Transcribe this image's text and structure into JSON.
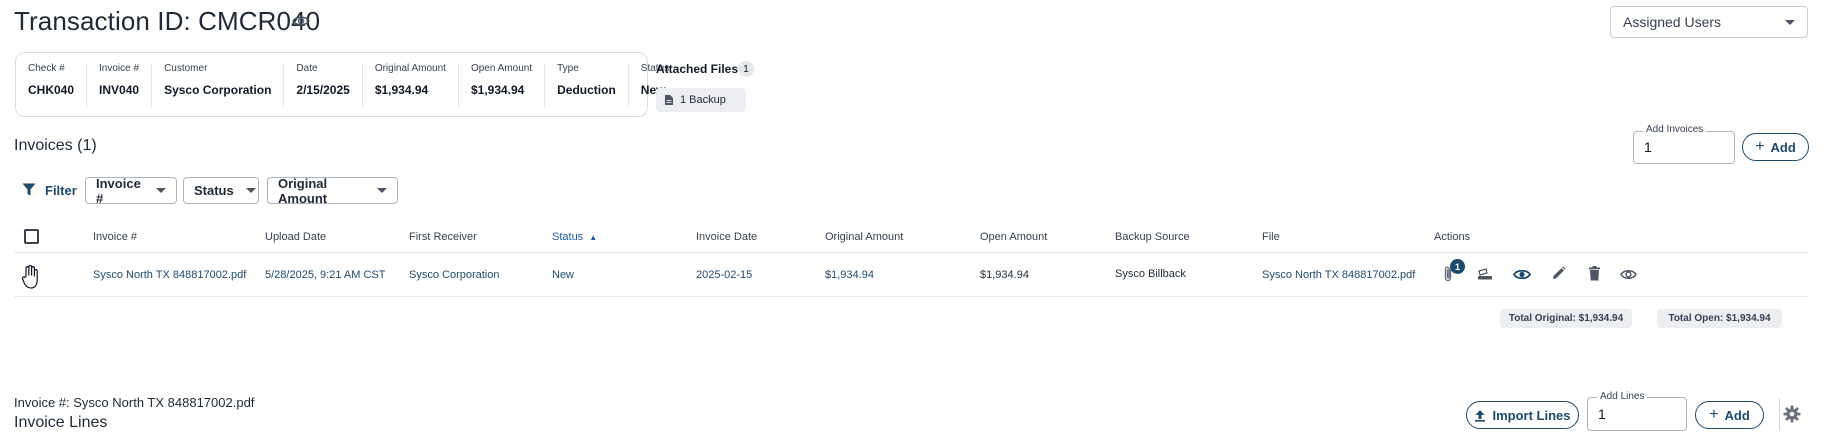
{
  "header": {
    "title": "Transaction ID: CMCR040",
    "assigned_users_label": "Assigned Users"
  },
  "summary": {
    "fields": [
      {
        "label": "Check #",
        "value": "CHK040"
      },
      {
        "label": "Invoice #",
        "value": "INV040"
      },
      {
        "label": "Customer",
        "value": "Sysco Corporation"
      },
      {
        "label": "Date",
        "value": "2/15/2025"
      },
      {
        "label": "Original Amount",
        "value": "$1,934.94"
      },
      {
        "label": "Open Amount",
        "value": "$1,934.94"
      },
      {
        "label": "Type",
        "value": "Deduction"
      },
      {
        "label": "Status",
        "value": "New"
      }
    ]
  },
  "attached_files": {
    "title": "Attached Files",
    "count": "1",
    "backup_label": "1 Backup"
  },
  "invoices": {
    "title": "Invoices (1)",
    "add_invoices_legend": "Add Invoices",
    "add_invoices_value": "1",
    "add_label": "Add",
    "filter_label": "Filter",
    "filters": [
      "Invoice #",
      "Status",
      "Original Amount"
    ],
    "columns": [
      "Invoice #",
      "Upload Date",
      "First Receiver",
      "Status",
      "Invoice Date",
      "Original Amount",
      "Open Amount",
      "Backup Source",
      "File",
      "Actions"
    ],
    "rows": [
      {
        "invoice_no": "Sysco North TX 848817002.pdf",
        "upload_date": "5/28/2025, 9:21 AM CST",
        "first_receiver": "Sysco Corporation",
        "status": "New",
        "invoice_date": "2025-02-15",
        "original_amount": "$1,934.94",
        "open_amount": "$1,934.94",
        "backup_source": "Sysco Billback",
        "file": "Sysco North TX 848817002.pdf",
        "attachment_count": "1"
      }
    ],
    "total_original": "Total Original: $1,934.94",
    "total_open": "Total Open: $1,934.94"
  },
  "invoice_lines": {
    "subtitle": "Invoice #: Sysco North TX 848817002.pdf",
    "title": "Invoice Lines",
    "import_label": "Import Lines",
    "add_lines_legend": "Add Lines",
    "add_lines_value": "1",
    "add_label": "Add"
  },
  "colors": {
    "accent": "#1e4a6b",
    "link": "#1e4a6b",
    "sort_header": "#1e5aa8"
  }
}
